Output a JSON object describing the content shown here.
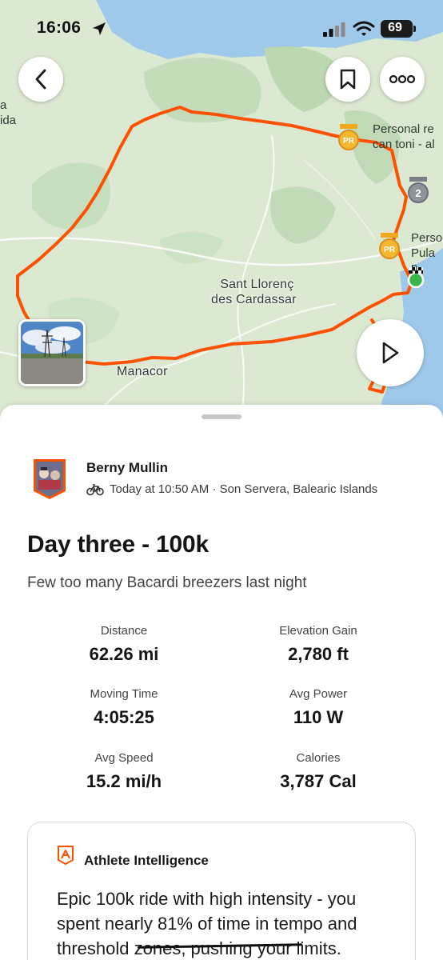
{
  "status_bar": {
    "time": "16:06",
    "battery": "69"
  },
  "map": {
    "labels": {
      "town_center": "Sant Llorenç des Cardassar",
      "town_center_line1": "Sant Llorenç",
      "town_center_line2": "des Cardassar",
      "town_south": "Manacor",
      "edge_left_1": "a",
      "edge_left_2": "ida",
      "segment_1_line1": "Personal re",
      "segment_1_line2": "can toni - al",
      "segment_2_line1": "Perso",
      "segment_2_line2": "Pula p"
    },
    "badges": {
      "pr": "PR",
      "rank": "2"
    },
    "route_color": "#fc5200"
  },
  "activity": {
    "athlete": "Berny Mullin",
    "meta": "Today at 10:50 AM · Son Servera, Balearic Islands",
    "sport_icon": "bike-icon",
    "title": "Day three - 100k",
    "description": "Few too many Bacardi breezers last night"
  },
  "stats": [
    {
      "label": "Distance",
      "value": "62.26 mi"
    },
    {
      "label": "Elevation Gain",
      "value": "2,780 ft"
    },
    {
      "label": "Moving Time",
      "value": "4:05:25"
    },
    {
      "label": "Avg Power",
      "value": "110 W"
    },
    {
      "label": "Avg Speed",
      "value": "15.2 mi/h"
    },
    {
      "label": "Calories",
      "value": "3,787 Cal"
    }
  ],
  "athlete_intelligence": {
    "title": "Athlete Intelligence",
    "text": "Epic 100k ride with high intensity - you spent nearly 81% of time in tempo and threshold zones, pushing your limits."
  },
  "colors": {
    "brand": "#fc5200",
    "water": "#9fc9ea",
    "land": "#d8e8cf"
  }
}
